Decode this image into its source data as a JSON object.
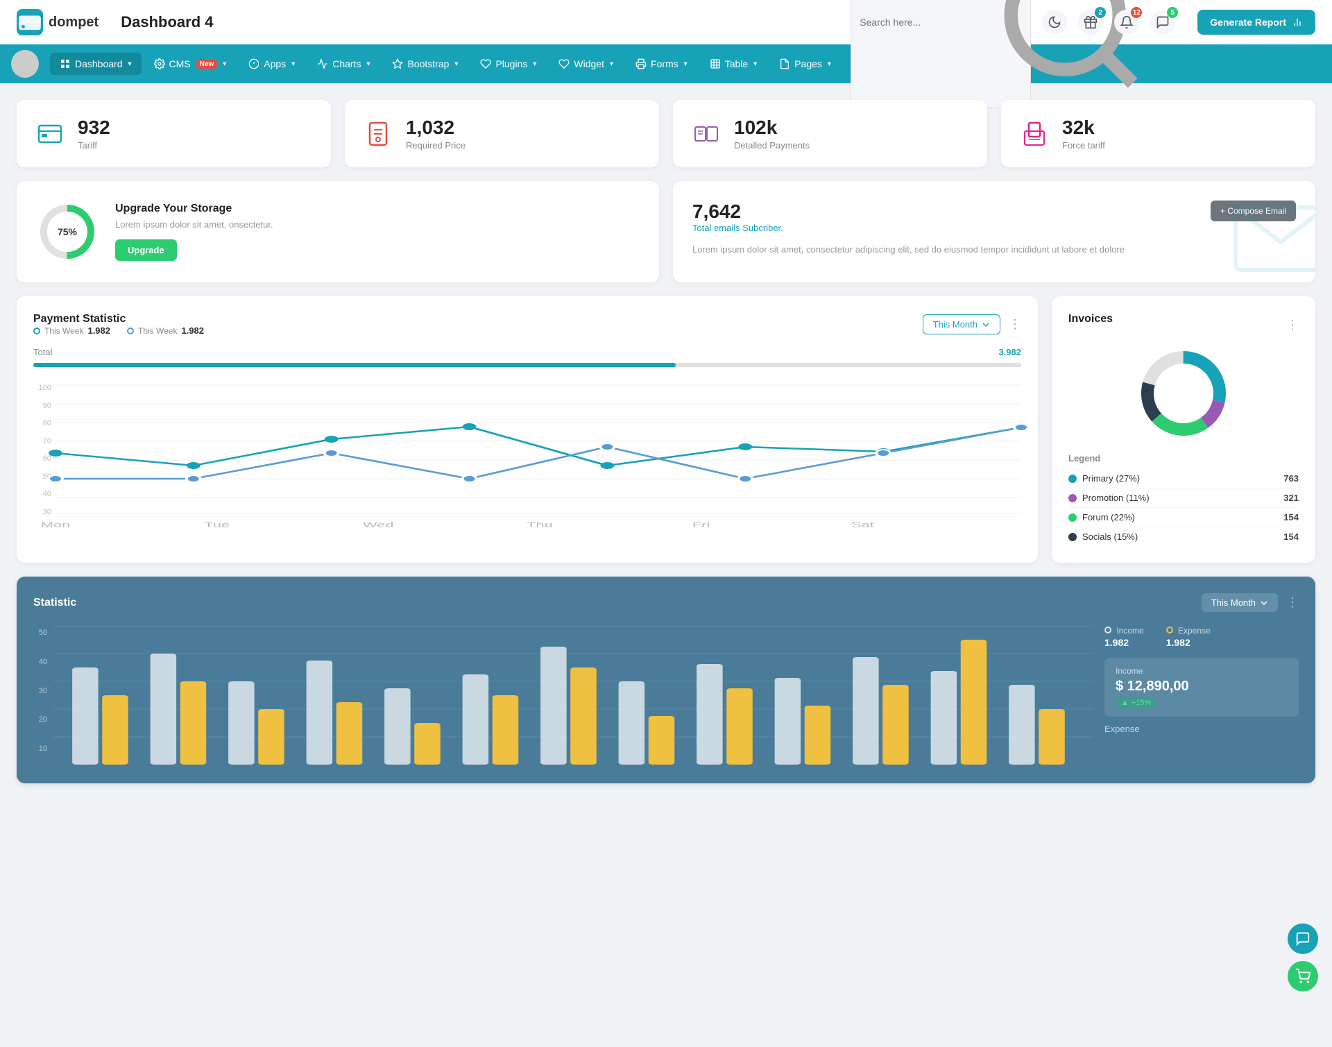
{
  "header": {
    "logo_text": "dompet",
    "page_title": "Dashboard 4",
    "search_placeholder": "Search here...",
    "generate_btn": "Generate Report",
    "icons": {
      "moon": "🌙",
      "gift_badge": "2",
      "bell_badge": "12",
      "chat_badge": "5"
    }
  },
  "navbar": {
    "items": [
      {
        "label": "Dashboard",
        "icon": "grid",
        "active": true,
        "badge": ""
      },
      {
        "label": "CMS",
        "icon": "gear",
        "active": false,
        "badge": "New"
      },
      {
        "label": "Apps",
        "icon": "info",
        "active": false,
        "badge": ""
      },
      {
        "label": "Charts",
        "icon": "chart",
        "active": false,
        "badge": ""
      },
      {
        "label": "Bootstrap",
        "icon": "star",
        "active": false,
        "badge": ""
      },
      {
        "label": "Plugins",
        "icon": "heart",
        "active": false,
        "badge": ""
      },
      {
        "label": "Widget",
        "icon": "widget",
        "active": false,
        "badge": ""
      },
      {
        "label": "Forms",
        "icon": "printer",
        "active": false,
        "badge": ""
      },
      {
        "label": "Table",
        "icon": "table",
        "active": false,
        "badge": ""
      },
      {
        "label": "Pages",
        "icon": "pages",
        "active": false,
        "badge": ""
      }
    ]
  },
  "stat_cards": [
    {
      "number": "932",
      "label": "Tariff",
      "icon_color": "#17a2b8"
    },
    {
      "number": "1,032",
      "label": "Required Price",
      "icon_color": "#e74c3c"
    },
    {
      "number": "102k",
      "label": "Detalled Payments",
      "icon_color": "#9b59b6"
    },
    {
      "number": "32k",
      "label": "Force tariff",
      "icon_color": "#e91e8c"
    }
  ],
  "storage": {
    "percent": "75%",
    "title": "Upgrade Your Storage",
    "desc": "Lorem ipsum dolor sit amet, onsectetur.",
    "btn_label": "Upgrade"
  },
  "email": {
    "count": "7,642",
    "subtitle": "Total emails Subcriber.",
    "desc": "Lorem ipsum dolor sit amet, consectetur adipiscing elit, sed do eiusmod tempor incididunt ut labore et dolore",
    "compose_btn": "+ Compose Email"
  },
  "payment_chart": {
    "title": "Payment Statistic",
    "filter": "This Month",
    "legend": [
      {
        "label": "This Week",
        "value": "1.982",
        "color": "teal"
      },
      {
        "label": "This Week",
        "value": "1.982",
        "color": "blue"
      }
    ],
    "total_label": "Total",
    "total_value": "3.982",
    "x_labels": [
      "Mon",
      "Tue",
      "Wed",
      "Thu",
      "Fri",
      "Sat"
    ],
    "y_labels": [
      "100",
      "90",
      "80",
      "70",
      "60",
      "50",
      "40",
      "30"
    ],
    "line1": [
      60,
      50,
      70,
      80,
      50,
      65,
      58,
      85
    ],
    "line2": [
      40,
      40,
      70,
      40,
      65,
      40,
      62,
      85
    ]
  },
  "invoices": {
    "title": "Invoices",
    "donut": {
      "segments": [
        {
          "label": "Primary (27%)",
          "color": "#17a2b8",
          "value": 763,
          "pct": 27
        },
        {
          "label": "Promotion (11%)",
          "color": "#9b59b6",
          "value": 321,
          "pct": 11
        },
        {
          "label": "Forum (22%)",
          "color": "#2ecc71",
          "value": 154,
          "pct": 22
        },
        {
          "label": "Socials (15%)",
          "color": "#2c3e50",
          "value": 154,
          "pct": 15
        }
      ]
    }
  },
  "statistic": {
    "title": "Statistic",
    "filter": "This Month",
    "y_labels": [
      "50",
      "40",
      "30",
      "20",
      "10"
    ],
    "income_label": "Income",
    "income_val": "1.982",
    "expense_label": "Expense",
    "expense_val": "1.982",
    "income_detail": {
      "label": "Income",
      "value": "$ 12,890,00",
      "badge": "+15%"
    },
    "expense_detail_label": "Expense"
  }
}
